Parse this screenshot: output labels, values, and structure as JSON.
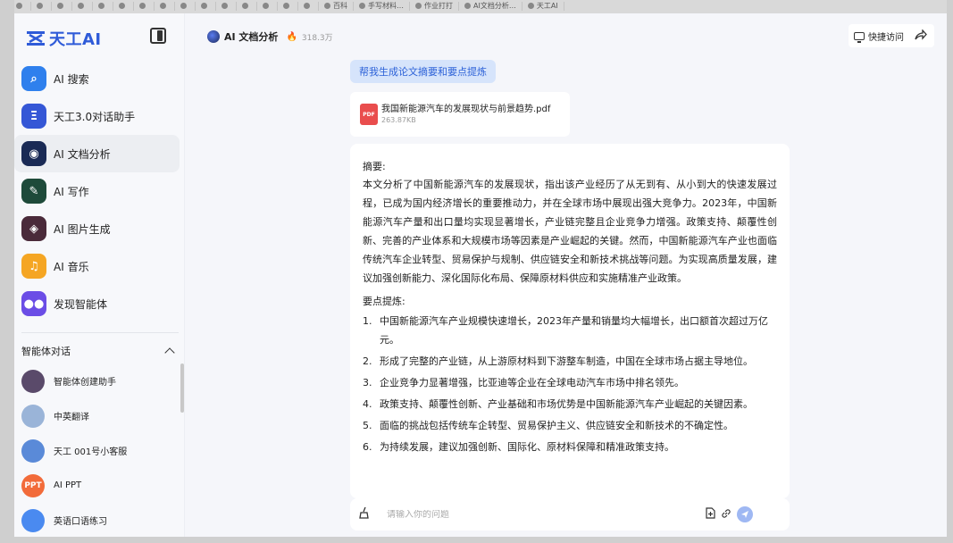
{
  "browser_tabs": [
    "",
    "",
    "",
    "",
    "",
    "",
    "",
    "",
    "",
    "",
    "",
    "",
    "",
    "",
    "",
    "百科",
    "手写材料…",
    "作业打打",
    "AI文档分析…",
    "天工AI"
  ],
  "app": {
    "logo_text": "天工AI"
  },
  "sidebar": {
    "items": [
      {
        "label": "AI 搜索",
        "icon": "search-icon",
        "color": "#2f80ed"
      },
      {
        "label": "天工3.0对话助手",
        "icon": "chat-logo-icon",
        "color": "#3557d6"
      },
      {
        "label": "AI 文档分析",
        "icon": "document-robot-icon",
        "color": "#1a2a55"
      },
      {
        "label": "AI 写作",
        "icon": "writing-icon",
        "color": "#1e4a3a"
      },
      {
        "label": "AI 图片生成",
        "icon": "image-gen-icon",
        "color": "#4a2a3a"
      },
      {
        "label": "AI 音乐",
        "icon": "music-icon",
        "color": "#f5a623"
      },
      {
        "label": "发现智能体",
        "icon": "agent-icon",
        "color": "#6b4de6"
      }
    ],
    "section_title": "智能体对话",
    "agents": [
      {
        "label": "智能体创建助手",
        "color": "#5a4a6a",
        "initials": ""
      },
      {
        "label": "中英翻译",
        "color": "#9ab4d8",
        "initials": ""
      },
      {
        "label": "天工 001号小客服",
        "color": "#5a8ad8",
        "initials": ""
      },
      {
        "label": "AI PPT",
        "color": "#f26b3a",
        "initials": "PPT"
      },
      {
        "label": "英语口语练习",
        "color": "#4a8af0",
        "initials": ""
      }
    ]
  },
  "header": {
    "title": "AI 文档分析",
    "heat": "318.3万",
    "quick_access": "快捷访问"
  },
  "conversation": {
    "user_message": "帮我生成论文摘要和要点提炼",
    "file": {
      "name": "我国新能源汽车的发展现状与前景趋势.pdf",
      "size": "263.87KB",
      "type": "PDF"
    },
    "answer": {
      "summary_heading": "摘要:",
      "summary": "本文分析了中国新能源汽车的发展现状，指出该产业经历了从无到有、从小到大的快速发展过程，已成为国内经济增长的重要推动力，并在全球市场中展现出强大竞争力。2023年，中国新能源汽车产量和出口量均实现显著增长，产业链完整且企业竞争力增强。政策支持、颠覆性创新、完善的产业体系和大规模市场等因素是产业崛起的关键。然而，中国新能源汽车产业也面临传统汽车企业转型、贸易保护与规制、供应链安全和新技术挑战等问题。为实现高质量发展，建议加强创新能力、深化国际化布局、保障原材料供应和实施精准产业政策。",
      "points_heading": "要点提炼:",
      "points": [
        {
          "num": "1.",
          "text": "中国新能源汽车产业规模快速增长，2023年产量和销量均大幅增长，出口额首次超过万亿元。"
        },
        {
          "num": "2.",
          "text": "形成了完整的产业链，从上游原材料到下游整车制造，中国在全球市场占据主导地位。"
        },
        {
          "num": "3.",
          "text": "企业竞争力显著增强，比亚迪等企业在全球电动汽车市场中排名领先。"
        },
        {
          "num": "4.",
          "text": "政策支持、颠覆性创新、产业基础和市场优势是中国新能源汽车产业崛起的关键因素。"
        },
        {
          "num": "5.",
          "text": "面临的挑战包括传统车企转型、贸易保护主义、供应链安全和新技术的不确定性。"
        },
        {
          "num": "6.",
          "text": "为持续发展，建议加强创新、国际化、原材料保障和精准政策支持。"
        }
      ]
    }
  },
  "input": {
    "placeholder": "请输入你的问题",
    "value": ""
  }
}
